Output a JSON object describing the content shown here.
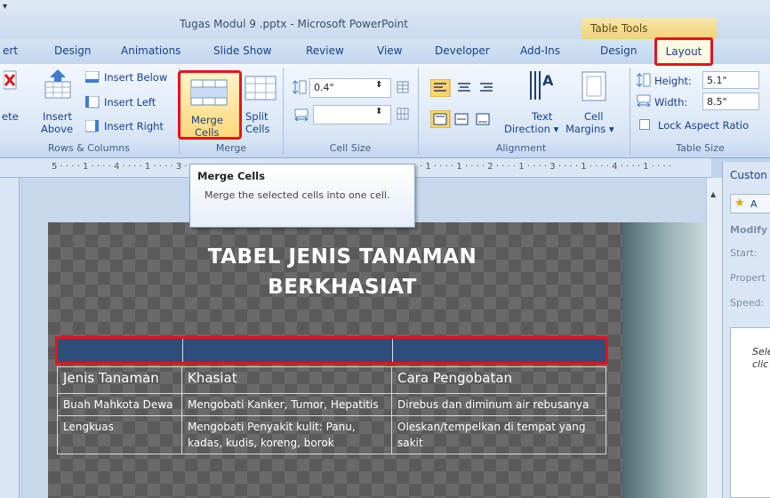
{
  "titlebar": {
    "title": "Tugas Modul 9 .pptx - Microsoft PowerPoint",
    "context": "Table Tools"
  },
  "tabs": {
    "items": [
      "ert",
      "Design",
      "Animations",
      "Slide Show",
      "Review",
      "View",
      "Developer",
      "Add-Ins",
      "Design"
    ],
    "active": "Layout"
  },
  "ribbon": {
    "rows_columns": {
      "delete_partial": "ete",
      "insert_above_1": "Insert",
      "insert_above_2": "Above",
      "insert_below": "Insert Below",
      "insert_left": "Insert Left",
      "insert_right": "Insert Right",
      "group_label": "Rows & Columns"
    },
    "merge": {
      "merge_1": "Merge",
      "merge_2": "Cells",
      "split_1": "Split",
      "split_2": "Cells",
      "group_label": "Merge"
    },
    "cell_size": {
      "height_value": "0.4\"",
      "width_value": "",
      "group_label": "Cell Size"
    },
    "alignment": {
      "text_direction_1": "Text",
      "text_direction_2": "Direction ▾",
      "cell_margins_1": "Cell",
      "cell_margins_2": "Margins ▾",
      "group_label": "Alignment"
    },
    "table_size": {
      "height_label": "Height:",
      "height_value": "5.1\"",
      "width_label": "Width:",
      "width_value": "8.5\"",
      "lock_label": "Lock Aspect Ratio",
      "group_label": "Table Size"
    }
  },
  "ruler_text": "5 · · · · 1 · · · · 4 · · · · 1 · · · · 3 · · ·",
  "ruler_text_right": "· 1 · · · · 1 · · · · 2 · · · · 1 · · · · 3 · · · · 1 · · · · 4 · · · · 1 · · · ·",
  "tooltip": {
    "title": "Merge Cells",
    "text": "Merge the selected cells into one cell."
  },
  "slide": {
    "title_line1": "TABEL JENIS TANAMAN",
    "title_line2": "BERKHASIAT",
    "table": {
      "headers": [
        "Jenis Tanaman",
        "Khasiat",
        "Cara Pengobatan"
      ],
      "rows": [
        [
          "Buah Mahkota Dewa",
          "Mengobati Kanker, Tumor, Hepatitis",
          "Direbus dan diminum air rebusanya"
        ],
        [
          "Lengkuas",
          "Mengobati Penyakit kulit: Panu, kadas, kudis, koreng, borok",
          "Oleskan/tempelkan di tempat yang sakit"
        ]
      ]
    }
  },
  "pane": {
    "header": "Custon",
    "add_btn": "A",
    "modify": "Modify",
    "start": "Start:",
    "property": "Propert",
    "speed": "Speed:",
    "hint1": "Sele",
    "hint2": "clic"
  }
}
